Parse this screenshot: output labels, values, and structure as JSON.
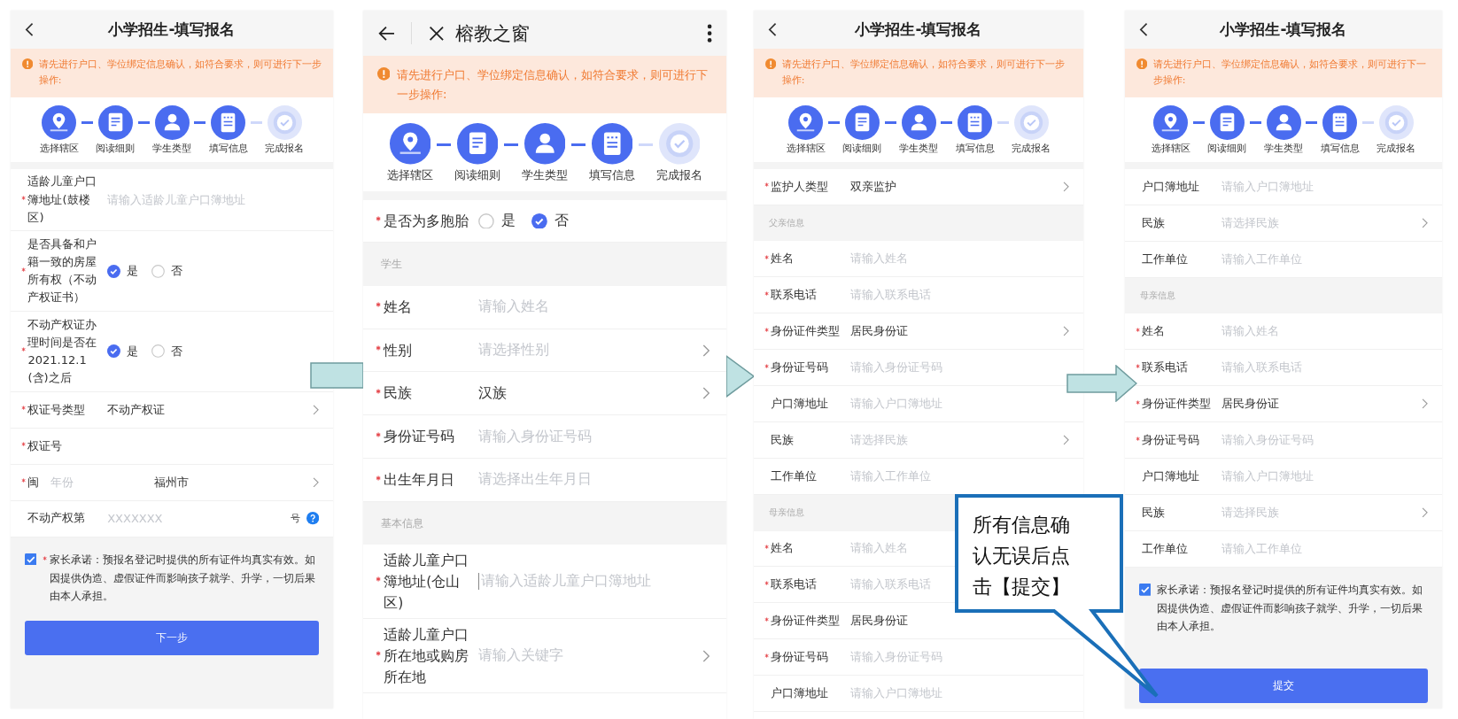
{
  "panels": [
    {
      "header": {
        "kind": "title",
        "title": "小学招生-填写报名"
      },
      "notice": "请先进行户口、学位绑定信息确认，如符合要求，则可进行下一步操作:",
      "steps": [
        {
          "label": "选择辖区",
          "active": true
        },
        {
          "label": "阅读细则",
          "active": true
        },
        {
          "label": "学生类型",
          "active": true
        },
        {
          "label": "填写信息",
          "active": true
        },
        {
          "label": "完成报名",
          "active": false
        }
      ],
      "rows": [
        {
          "kind": "field",
          "label": "适龄儿童户口簿地址(鼓楼区)",
          "required": true,
          "placeholder": "请输入适龄儿童户口簿地址"
        },
        {
          "kind": "radio",
          "label": "是否具备和户籍一致的房屋所有权（不动产权证书）",
          "required": true,
          "options": [
            {
              "label": "是",
              "selected": true
            },
            {
              "label": "否",
              "selected": false
            }
          ]
        },
        {
          "kind": "radio",
          "label": "不动产权证办理时间是否在2021.12.1(含)之后",
          "required": true,
          "options": [
            {
              "label": "是",
              "selected": true
            },
            {
              "label": "否",
              "selected": false
            }
          ]
        },
        {
          "kind": "field",
          "label": "权证号类型",
          "required": true,
          "value": "不动产权证",
          "chevron": true
        },
        {
          "kind": "field",
          "label": "权证号",
          "required": true
        },
        {
          "kind": "region",
          "label": "闽",
          "required": true,
          "placeholder": "年份",
          "value": "福州市",
          "chevron": true
        },
        {
          "kind": "cert",
          "label": "不动产权第",
          "required": false,
          "placeholder": "XXXXXXX",
          "suffix": "号"
        }
      ],
      "pledge": {
        "checked": true,
        "required": true,
        "text": "家长承诺：预报名登记时提供的所有证件均真实有效。如因提供伪造、虚假证件而影响孩子就学、升学，一切后果由本人承担。"
      },
      "button": "下一步"
    },
    {
      "header": {
        "kind": "browser",
        "title": "榕教之窗"
      },
      "notice": "请先进行户口、学位绑定信息确认，如符合要求，则可进行下一步操作:",
      "steps": [
        {
          "label": "选择辖区",
          "active": true
        },
        {
          "label": "阅读细则",
          "active": true
        },
        {
          "label": "学生类型",
          "active": true
        },
        {
          "label": "填写信息",
          "active": true
        },
        {
          "label": "完成报名",
          "active": false
        }
      ],
      "rows": [
        {
          "kind": "radio",
          "label": "是否为多胞胎",
          "required": true,
          "options": [
            {
              "label": "是",
              "selected": false
            },
            {
              "label": "否",
              "selected": true
            }
          ]
        },
        {
          "kind": "section",
          "label": "学生"
        },
        {
          "kind": "field",
          "label": "姓名",
          "required": true,
          "placeholder": "请输入姓名"
        },
        {
          "kind": "field",
          "label": "性别",
          "required": true,
          "placeholder": "请选择性别",
          "chevron": true
        },
        {
          "kind": "field",
          "label": "民族",
          "required": true,
          "value": "汉族",
          "chevron": true
        },
        {
          "kind": "field",
          "label": "身份证号码",
          "required": true,
          "placeholder": "请输入身份证号码"
        },
        {
          "kind": "field",
          "label": "出生年月日",
          "required": true,
          "placeholder": "请选择出生年月日"
        },
        {
          "kind": "section",
          "label": "基本信息"
        },
        {
          "kind": "field",
          "label": "适龄儿童户口簿地址(仓山区)",
          "required": true,
          "placeholder": "请输入适龄儿童户口簿地址",
          "focused": true
        },
        {
          "kind": "field",
          "label": "适龄儿童户口所在地或购房所在地",
          "required": true,
          "placeholder": "请输入关键字",
          "chevron": true
        }
      ]
    },
    {
      "header": {
        "kind": "title",
        "title": "小学招生-填写报名"
      },
      "notice": "请先进行户口、学位绑定信息确认，如符合要求，则可进行下一步操作:",
      "steps": [
        {
          "label": "选择辖区",
          "active": true
        },
        {
          "label": "阅读细则",
          "active": true
        },
        {
          "label": "学生类型",
          "active": true
        },
        {
          "label": "填写信息",
          "active": true
        },
        {
          "label": "完成报名",
          "active": false
        }
      ],
      "rows": [
        {
          "kind": "field",
          "label": "监护人类型",
          "required": true,
          "value": "双亲监护",
          "chevron": true
        },
        {
          "kind": "section",
          "label": "父亲信息"
        },
        {
          "kind": "field",
          "label": "姓名",
          "required": true,
          "placeholder": "请输入姓名"
        },
        {
          "kind": "field",
          "label": "联系电话",
          "required": true,
          "placeholder": "请输入联系电话"
        },
        {
          "kind": "field",
          "label": "身份证件类型",
          "required": true,
          "value": "居民身份证",
          "chevron": true
        },
        {
          "kind": "field",
          "label": "身份证号码",
          "required": true,
          "placeholder": "请输入身份证号码"
        },
        {
          "kind": "field",
          "label": "户口簿地址",
          "required": false,
          "placeholder": "请输入户口簿地址"
        },
        {
          "kind": "field",
          "label": "民族",
          "required": false,
          "placeholder": "请选择民族",
          "chevron": true
        },
        {
          "kind": "field",
          "label": "工作单位",
          "required": false,
          "placeholder": "请输入工作单位"
        },
        {
          "kind": "section",
          "label": "母亲信息"
        },
        {
          "kind": "field",
          "label": "姓名",
          "required": true,
          "placeholder": "请输入姓名"
        },
        {
          "kind": "field",
          "label": "联系电话",
          "required": true,
          "placeholder": "请输入联系电话"
        },
        {
          "kind": "field",
          "label": "身份证件类型",
          "required": true,
          "value": "居民身份证"
        },
        {
          "kind": "field",
          "label": "身份证号码",
          "required": true,
          "placeholder": "请输入身份证号码"
        },
        {
          "kind": "field",
          "label": "户口簿地址",
          "required": false,
          "placeholder": "请输入户口簿地址"
        }
      ]
    },
    {
      "header": {
        "kind": "title",
        "title": "小学招生-填写报名"
      },
      "notice": "请先进行户口、学位绑定信息确认，如符合要求，则可进行下一步操作:",
      "steps": [
        {
          "label": "选择辖区",
          "active": true
        },
        {
          "label": "阅读细则",
          "active": true
        },
        {
          "label": "学生类型",
          "active": true
        },
        {
          "label": "填写信息",
          "active": true
        },
        {
          "label": "完成报名",
          "active": false
        }
      ],
      "rows": [
        {
          "kind": "field",
          "label": "户口簿地址",
          "required": false,
          "placeholder": "请输入户口簿地址"
        },
        {
          "kind": "field",
          "label": "民族",
          "required": false,
          "placeholder": "请选择民族",
          "chevron": true
        },
        {
          "kind": "field",
          "label": "工作单位",
          "required": false,
          "placeholder": "请输入工作单位"
        },
        {
          "kind": "section",
          "label": "母亲信息"
        },
        {
          "kind": "field",
          "label": "姓名",
          "required": true,
          "placeholder": "请输入姓名"
        },
        {
          "kind": "field",
          "label": "联系电话",
          "required": true,
          "placeholder": "请输入联系电话"
        },
        {
          "kind": "field",
          "label": "身份证件类型",
          "required": true,
          "value": "居民身份证",
          "chevron": true
        },
        {
          "kind": "field",
          "label": "身份证号码",
          "required": true,
          "placeholder": "请输入身份证号码"
        },
        {
          "kind": "field",
          "label": "户口簿地址",
          "required": false,
          "placeholder": "请输入户口簿地址"
        },
        {
          "kind": "field",
          "label": "民族",
          "required": false,
          "placeholder": "请选择民族",
          "chevron": true
        },
        {
          "kind": "field",
          "label": "工作单位",
          "required": false,
          "placeholder": "请输入工作单位"
        }
      ],
      "pledge": {
        "checked": true,
        "text": "家长承诺：预报名登记时提供的所有证件均真实有效。如因提供伪造、虚假证件而影响孩子就学、升学，一切后果由本人承担。"
      },
      "button": "提交"
    }
  ],
  "callout": {
    "text": "所有信息确认无误后点击【提交】"
  }
}
